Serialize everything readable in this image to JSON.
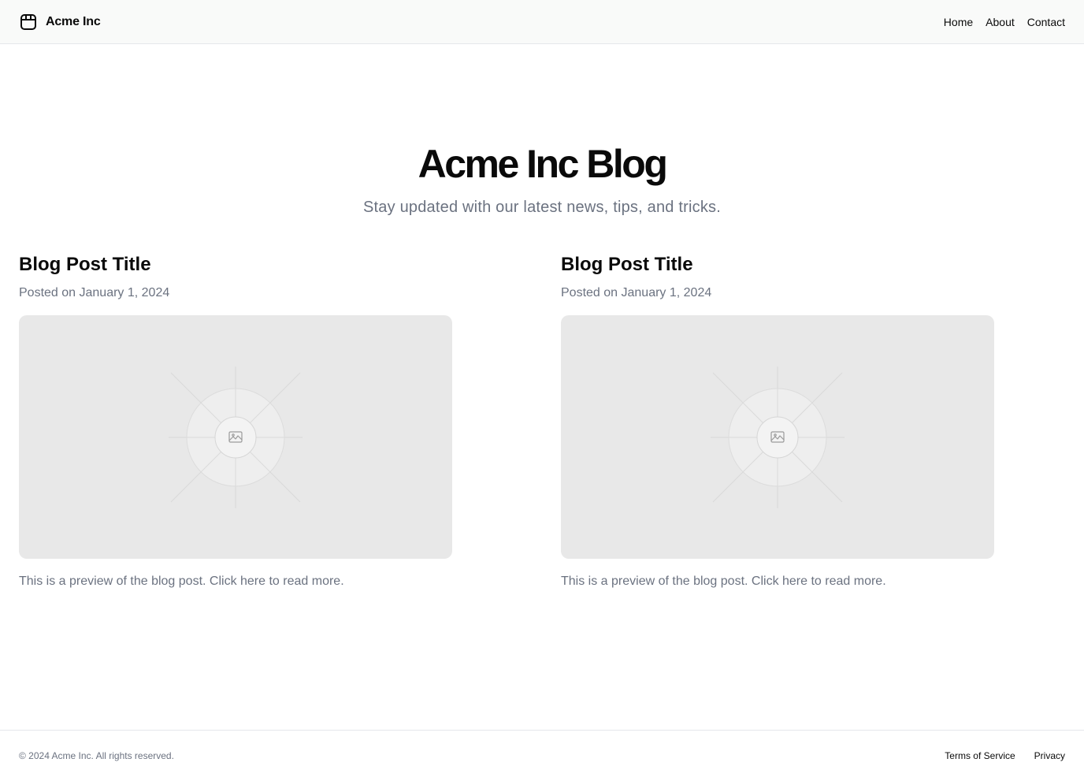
{
  "header": {
    "brand_name": "Acme Inc",
    "brand_icon": "package-icon",
    "nav": [
      {
        "label": "Home"
      },
      {
        "label": "About"
      },
      {
        "label": "Contact"
      }
    ]
  },
  "hero": {
    "title": "Acme Inc Blog",
    "subtitle": "Stay updated with our latest news, tips, and tricks."
  },
  "posts": [
    {
      "title": "Blog Post Title",
      "date": "Posted on January 1, 2024",
      "image_icon": "image-placeholder-icon",
      "excerpt": "This is a preview of the blog post. Click here to read more."
    },
    {
      "title": "Blog Post Title",
      "date": "Posted on January 1, 2024",
      "image_icon": "image-placeholder-icon",
      "excerpt": "This is a preview of the blog post. Click here to read more."
    }
  ],
  "footer": {
    "copyright": "© 2024 Acme Inc. All rights reserved.",
    "links": [
      {
        "label": "Terms of Service"
      },
      {
        "label": "Privacy"
      }
    ]
  },
  "colors": {
    "text_primary": "#0a0a0a",
    "text_muted": "#6b7280",
    "header_bg": "#f9faf9",
    "placeholder_bg": "#e8e8e8",
    "border": "#e5e7eb"
  }
}
